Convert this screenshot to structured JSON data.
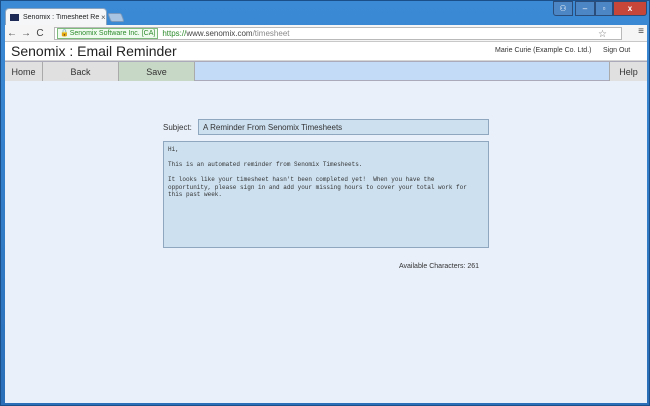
{
  "browser": {
    "tab_title": "Senomix : Timesheet Rem",
    "tab_close": "×",
    "ev_badge": "Senomix Software Inc. [CA]",
    "url_scheme": "https://",
    "url_host": "www.senomix.com",
    "url_path": "/timesheet",
    "back_glyph": "←",
    "forward_glyph": "→",
    "reload_glyph": "C",
    "star_glyph": "☆",
    "menu_glyph": "≡",
    "lock_glyph": "🔒"
  },
  "window_controls": {
    "user_glyph": "⚇",
    "min_glyph": "–",
    "max_glyph": "▫",
    "close_glyph": "x"
  },
  "app": {
    "title": "Senomix : Email Reminder",
    "user": "Marie Curie  (Example Co. Ltd.)",
    "sign_out": "Sign Out"
  },
  "nav": {
    "home": "Home",
    "back": "Back",
    "save": "Save",
    "help": "Help"
  },
  "form": {
    "subject_label": "Subject:",
    "subject_value": "A Reminder From Senomix Timesheets",
    "body_value": "Hi,\n\nThis is an automated reminder from Senomix Timesheets.\n\nIt looks like your timesheet hasn't been completed yet!  When you have the\nopportunity, please sign in and add your missing hours to cover your total work for\nthis past week.",
    "available_chars": "Available Characters: 261"
  },
  "colors": {
    "page_bg": "#e9f0fa",
    "nav_bar": "#c4dbf8",
    "save_button": "#c8d8c6",
    "input_bg": "#cde0ef",
    "window_frame": "#2a6fb8"
  }
}
